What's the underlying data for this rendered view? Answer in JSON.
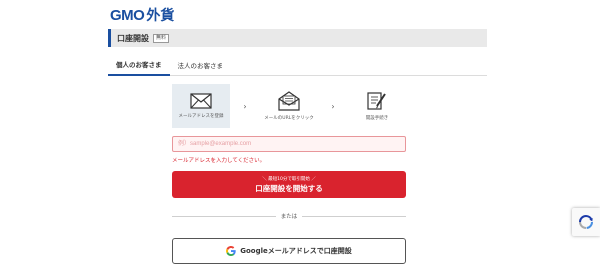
{
  "header": {
    "logo_gmo": "GMO",
    "logo_kanji": "外貨"
  },
  "page": {
    "title": "口座開設",
    "badge": "無料"
  },
  "tabs": [
    {
      "label": "個人のお客さま",
      "active": true
    },
    {
      "label": "法人のお客さま",
      "active": false
    }
  ],
  "steps": [
    {
      "icon": "envelope-icon",
      "label": "メールアドレスを登録",
      "active": true
    },
    {
      "icon": "open-mail-icon",
      "label": "メールのURLをクリック",
      "active": false
    },
    {
      "icon": "document-pen-icon",
      "label": "開設手続き",
      "active": false
    }
  ],
  "form": {
    "email_placeholder": "例）sample@example.com",
    "email_value": "",
    "error": "メールアドレスを入力してください。",
    "submit_sub": "＼ 最短10分で取引開始 ／",
    "submit_label": "口座開設を開始する",
    "divider": "または",
    "google_label": "Googleメールアドレスで口座開設"
  },
  "colors": {
    "brand_blue": "#1a4fa0",
    "cta_red": "#d9232e",
    "error_red": "#d9232e"
  },
  "recaptcha": {
    "icon": "recaptcha-icon"
  }
}
